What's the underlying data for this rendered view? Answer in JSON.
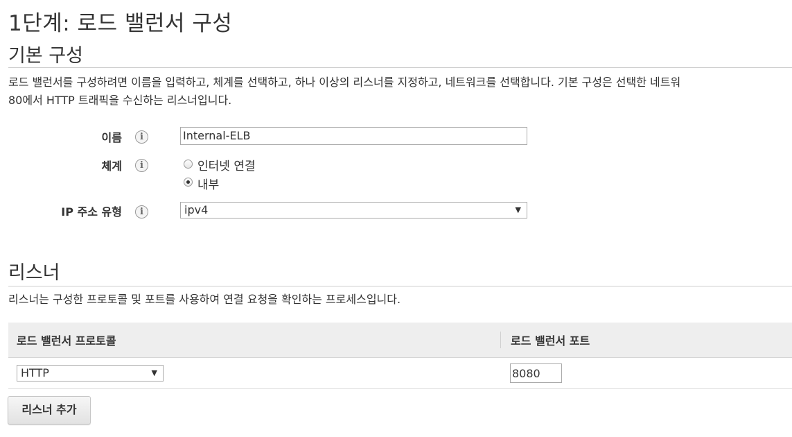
{
  "step_title": "1단계: 로드 밸런서 구성",
  "basic": {
    "heading": "기본 구성",
    "description_line1": "로드 밸런서를 구성하려면 이름을 입력하고, 체계를 선택하고, 하나 이상의 리스너를 지정하고, 네트워크를 선택합니다. 기본 구성은 선택한 네트워",
    "description_line2": "80에서 HTTP 트래픽을 수신하는 리스너입니다.",
    "name_label": "이름",
    "name_value": "Internal-ELB",
    "scheme_label": "체계",
    "scheme_options": [
      "인터넷 연결",
      "내부"
    ],
    "scheme_selected": "내부",
    "ip_label": "IP 주소 유형",
    "ip_value": "ipv4",
    "info_glyph": "i"
  },
  "listeners": {
    "heading": "리스너",
    "description": "리스너는 구성한 프로토콜 및 포트를 사용하여 연결 요청을 확인하는 프로세스입니다.",
    "col_protocol": "로드 밸런서 프로토콜",
    "col_port": "로드 밸런서 포트",
    "rows": [
      {
        "protocol": "HTTP",
        "port": "8080"
      }
    ],
    "add_button": "리스너 추가"
  },
  "icons": {
    "info": "info-icon",
    "dropdown": "chevron-down-icon",
    "caret_glyph": "▼"
  }
}
